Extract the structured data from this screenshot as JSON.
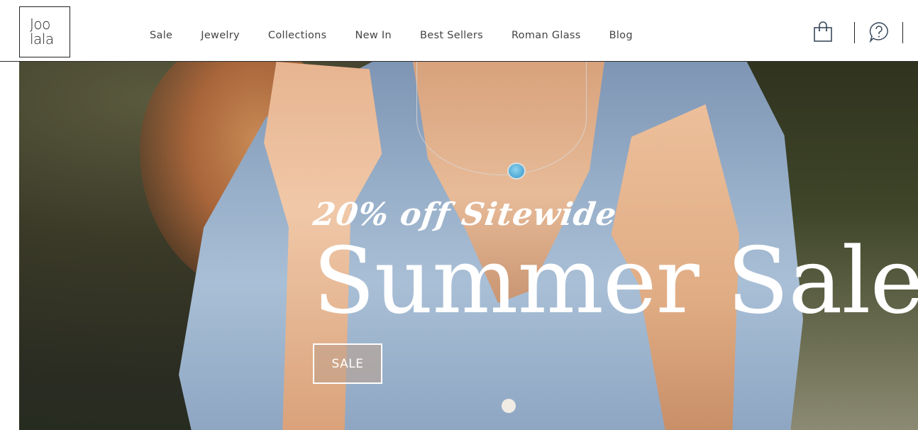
{
  "logo": {
    "line1": "Joo",
    "line2": "lala"
  },
  "nav": {
    "items": [
      {
        "label": "Sale"
      },
      {
        "label": "Jewelry"
      },
      {
        "label": "Collections"
      },
      {
        "label": "New In"
      },
      {
        "label": "Best Sellers"
      },
      {
        "label": "Roman Glass"
      },
      {
        "label": "Blog"
      }
    ]
  },
  "header_icons": {
    "bag": "shopping-bag-icon",
    "help": "help-chat-icon"
  },
  "hero": {
    "promo_text": "20% off Sitewide",
    "headline": "Summer Sale",
    "cta_label": "SALE"
  },
  "colors": {
    "text": "#444444",
    "border": "#222222",
    "hero_text": "#ffffff"
  }
}
